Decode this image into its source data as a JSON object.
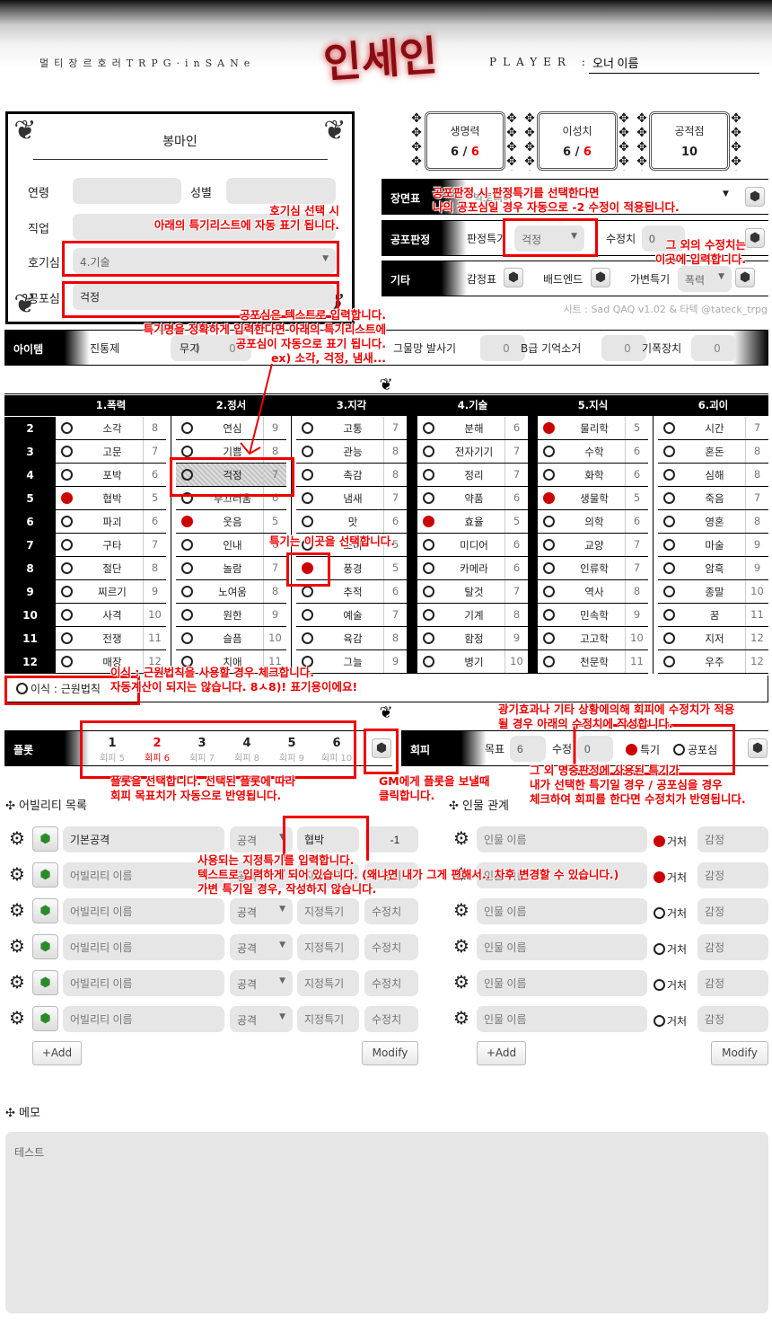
{
  "header": {
    "subtitle": "멀티장르호러TRPG·inSANe",
    "logo": "인세인",
    "player_label": "PLAYER :",
    "player_name": "오너 이름"
  },
  "profile": {
    "name": "봉마인",
    "age_label": "연령",
    "age": "",
    "gender_label": "성별",
    "gender": "",
    "job_label": "직업",
    "job": "",
    "curiosity_label": "호기심",
    "curiosity": "4.기술",
    "fear_label": "공포심",
    "fear": "걱정"
  },
  "stats": [
    {
      "label": "생명력",
      "current": "6",
      "sep": "/",
      "max": "6"
    },
    {
      "label": "이성치",
      "current": "6",
      "sep": "/",
      "max": "6"
    },
    {
      "label": "공적점",
      "value": "10"
    }
  ],
  "scene": {
    "label": "장면표",
    "value": "빅토리아"
  },
  "fear_check": {
    "label": "공포판정",
    "skill_label": "판정특기",
    "skill": "걱정",
    "mod_label": "수정치",
    "mod": "0"
  },
  "misc": {
    "label": "기타",
    "emotion_label": "감정표",
    "badend_label": "배드엔드",
    "variable_label": "가변특기",
    "variable": "폭력"
  },
  "credit": "시트 : Sad QAQ v1.02 & 타텍 @tateck_trpg",
  "items": {
    "label": "아이템",
    "list": [
      {
        "name": "진통제",
        "count": "0"
      },
      {
        "name": "무기",
        "count": "0"
      },
      {
        "name": "그물망 발사기",
        "count": "0"
      },
      {
        "name": "B급 기억소거",
        "count": "0"
      },
      {
        "name": "기폭장치",
        "count": "0"
      }
    ]
  },
  "skill_table": {
    "rows": [
      "2",
      "3",
      "4",
      "5",
      "6",
      "7",
      "8",
      "9",
      "10",
      "11",
      "12"
    ],
    "groups": [
      {
        "title": "1.폭력",
        "skills": [
          [
            "소각",
            "8",
            0
          ],
          [
            "고문",
            "7",
            0
          ],
          [
            "포박",
            "6",
            0
          ],
          [
            "협박",
            "5",
            1
          ],
          [
            "파괴",
            "6",
            0
          ],
          [
            "구타",
            "7",
            0
          ],
          [
            "절단",
            "8",
            0
          ],
          [
            "찌르기",
            "9",
            0
          ],
          [
            "사격",
            "10",
            0
          ],
          [
            "전쟁",
            "11",
            0
          ],
          [
            "매장",
            "12",
            0
          ]
        ]
      },
      {
        "title": "2.정서",
        "skills": [
          [
            "연심",
            "9",
            0
          ],
          [
            "기쁨",
            "8",
            0
          ],
          [
            "걱정",
            "7",
            0
          ],
          [
            "부끄러움",
            "6",
            0
          ],
          [
            "웃음",
            "5",
            1
          ],
          [
            "인내",
            "6",
            0
          ],
          [
            "놀람",
            "7",
            0
          ],
          [
            "노여움",
            "8",
            0
          ],
          [
            "원한",
            "9",
            0
          ],
          [
            "슬픔",
            "10",
            0
          ],
          [
            "치애",
            "11",
            0
          ]
        ]
      },
      {
        "title": "3.지각",
        "skills": [
          [
            "고통",
            "7",
            0
          ],
          [
            "관능",
            "8",
            0
          ],
          [
            "촉감",
            "8",
            0
          ],
          [
            "냄새",
            "7",
            0
          ],
          [
            "맛",
            "6",
            0
          ],
          [
            "소리",
            "5",
            0
          ],
          [
            "풍경",
            "5",
            1
          ],
          [
            "추적",
            "6",
            0
          ],
          [
            "예술",
            "7",
            0
          ],
          [
            "육감",
            "8",
            0
          ],
          [
            "그늘",
            "9",
            0
          ]
        ]
      },
      {
        "title": "4.기술",
        "skills": [
          [
            "분해",
            "6",
            0
          ],
          [
            "전자기기",
            "7",
            0
          ],
          [
            "정리",
            "7",
            0
          ],
          [
            "약품",
            "6",
            0
          ],
          [
            "효율",
            "5",
            1
          ],
          [
            "미디어",
            "6",
            0
          ],
          [
            "카메라",
            "6",
            0
          ],
          [
            "탈것",
            "7",
            0
          ],
          [
            "기계",
            "8",
            0
          ],
          [
            "함정",
            "9",
            0
          ],
          [
            "병기",
            "10",
            0
          ]
        ]
      },
      {
        "title": "5.지식",
        "skills": [
          [
            "물리학",
            "5",
            1
          ],
          [
            "수학",
            "6",
            0
          ],
          [
            "화학",
            "6",
            0
          ],
          [
            "생물학",
            "5",
            1
          ],
          [
            "의학",
            "6",
            0
          ],
          [
            "교양",
            "7",
            0
          ],
          [
            "인류학",
            "7",
            0
          ],
          [
            "역사",
            "8",
            0
          ],
          [
            "민속학",
            "9",
            0
          ],
          [
            "고고학",
            "10",
            0
          ],
          [
            "천문학",
            "11",
            0
          ]
        ]
      },
      {
        "title": "6.괴이",
        "skills": [
          [
            "시간",
            "7",
            0
          ],
          [
            "혼돈",
            "8",
            0
          ],
          [
            "심해",
            "8",
            0
          ],
          [
            "죽음",
            "7",
            0
          ],
          [
            "영혼",
            "8",
            0
          ],
          [
            "마술",
            "9",
            0
          ],
          [
            "암흑",
            "9",
            0
          ],
          [
            "종말",
            "10",
            0
          ],
          [
            "꿈",
            "11",
            0
          ],
          [
            "지저",
            "12",
            0
          ],
          [
            "우주",
            "12",
            0
          ]
        ]
      }
    ],
    "fear_skill": "걱정",
    "implant_label": "이식 : 근원법칙"
  },
  "plot": {
    "label": "플롯",
    "selected": 2,
    "items": [
      {
        "n": "1",
        "evade": "회피 5"
      },
      {
        "n": "2",
        "evade": "회피 6"
      },
      {
        "n": "3",
        "evade": "회피 7"
      },
      {
        "n": "4",
        "evade": "회피 8"
      },
      {
        "n": "5",
        "evade": "회피 9"
      },
      {
        "n": "6",
        "evade": "회피 10"
      }
    ]
  },
  "evade": {
    "label": "회피",
    "target_label": "목표",
    "target": "6",
    "mod_label": "수정",
    "mod": "0",
    "opt_skill": "특기",
    "opt_fear": "공포심"
  },
  "abilities": {
    "title": "어빌리티 목록",
    "add": "+Add",
    "modify": "Modify",
    "rows": [
      {
        "name": "기본공격",
        "type": "공격",
        "skill": "협박",
        "mod": "-1"
      },
      {
        "name": "",
        "type": "공격",
        "skill": "",
        "mod": ""
      },
      {
        "name": "",
        "type": "공격",
        "skill": "",
        "mod": ""
      },
      {
        "name": "",
        "type": "공격",
        "skill": "",
        "mod": ""
      },
      {
        "name": "",
        "type": "공격",
        "skill": "",
        "mod": ""
      },
      {
        "name": "",
        "type": "공격",
        "skill": "",
        "mod": ""
      }
    ],
    "ph_name": "어빌리티 이름",
    "ph_skill": "지정특기",
    "ph_mod": "수정치"
  },
  "relations": {
    "title": "인물 관계",
    "add": "+Add",
    "modify": "Modify",
    "ph_name": "인물 이름",
    "ph_emotion": "감정",
    "where_label": "거처",
    "rows": [
      {
        "where": 1
      },
      {
        "where": 1
      },
      {
        "where": 0
      },
      {
        "where": 0
      },
      {
        "where": 0
      },
      {
        "where": 0
      }
    ]
  },
  "memo": {
    "title": "메모",
    "text": "테스트"
  },
  "annotations": [
    {
      "id": "a1",
      "lines": [
        "호기심 선택 시",
        "아래의 특기리스트에 자동 표기 됩니다."
      ]
    },
    {
      "id": "a2",
      "lines": [
        "공포심은 텍스트로 입력합니다.",
        "특기명을 정확하게 입력한다면 아래의 특기리스트에",
        "공포심이 자동으로 표기 됩니다.",
        "ex) 소각, 걱정, 냄새..."
      ]
    },
    {
      "id": "a3",
      "lines": [
        "공포판정 시 판정특기를 선택한다면",
        "나의 공포심일 경우 자동으로 -2 수정이 적용됩니다."
      ]
    },
    {
      "id": "a4",
      "lines": [
        "그 외의 수정치는",
        "이곳에 입력합니다."
      ]
    },
    {
      "id": "a5",
      "lines": [
        "특기는 이곳을 선택합니다."
      ]
    },
    {
      "id": "a6",
      "lines": [
        "이식 : 근원법칙을 사용할 경우 체크합니다.",
        "자동계산이 되지는 않습니다. 8ㅅ8)! 표기용이에요!"
      ]
    },
    {
      "id": "a7",
      "lines": [
        "광기효과나 기타 상황에의해 회피에 수정치가 적용",
        "될 경우 아래의 수정치에 작성합니다."
      ]
    },
    {
      "id": "a8",
      "lines": [
        "플롯을 선택합니다. 선택된 플롯에 따라",
        "회피 목표치가 자동으로 반영됩니다."
      ]
    },
    {
      "id": "a9",
      "lines": [
        "GM에게 플롯을 보낼때",
        "클릭합니다."
      ]
    },
    {
      "id": "a10",
      "lines": [
        "그 외 명중판정에 사용된 특기가",
        "내가 선택한 특기일 경우 / 공포심을 경우",
        "체크하여 회피를 한다면 수정치가 반영됩니다."
      ]
    },
    {
      "id": "a11",
      "lines": [
        "사용되는 지정특기를 입력합니다.",
        "텍스트로 입력하게 되어 있습니다. (왜냐면 내가 그게 편해서.. 차후 변경할 수 있습니다.)",
        "가변 특기일 경우, 작성하지 않습니다."
      ]
    }
  ],
  "colors": {
    "accent": "#cc0000",
    "annotation": "#ee0000",
    "field": "#e6e6e6"
  }
}
